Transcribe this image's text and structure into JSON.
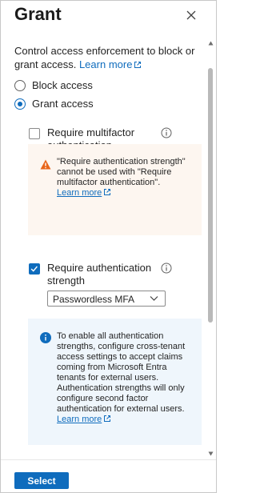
{
  "panel": {
    "title": "Grant",
    "description": "Control access enforcement to block or grant access.",
    "learn_more": "Learn more"
  },
  "access": {
    "options": [
      {
        "label": "Block access",
        "selected": false
      },
      {
        "label": "Grant access",
        "selected": true
      }
    ]
  },
  "controls": {
    "mfa": {
      "label": "Require multifactor authentication",
      "checked": false
    },
    "warning": {
      "text": "\"Require authentication strength\" cannot be used with \"Require multifactor authentication\".",
      "learn_more": "Learn more"
    },
    "auth_strength": {
      "label": "Require authentication strength",
      "checked": true
    },
    "strength_select": {
      "value": "Passwordless MFA"
    },
    "info": {
      "text": "To enable all authentication strengths, configure cross-tenant access settings to accept claims coming from Microsoft Entra tenants for external users. Authentication strengths will only configure second factor authentication for external users.",
      "learn_more": "Learn more"
    }
  },
  "footer": {
    "select_label": "Select"
  },
  "colors": {
    "accent": "#0f6cbd",
    "warning_bg": "#fdf6f0",
    "info_bg": "#eff6fc",
    "warning_icon": "#e8651a"
  }
}
